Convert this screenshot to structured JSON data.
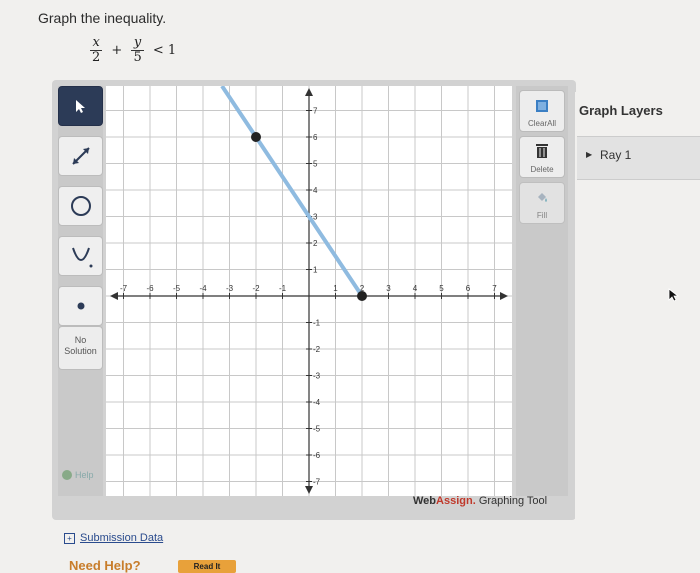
{
  "question": {
    "prompt": "Graph the inequality."
  },
  "inequality": {
    "term1_num": "x",
    "term1_den": "2",
    "plus": "+",
    "term2_num": "y",
    "term2_den": "5",
    "relation": "< 1"
  },
  "toolbar": {
    "tools": [
      {
        "name": "pointer",
        "icon": "arrow-cursor-icon",
        "active": true
      },
      {
        "name": "ray",
        "icon": "ray-icon"
      },
      {
        "name": "circle",
        "icon": "circle-icon"
      },
      {
        "name": "parabola",
        "icon": "parabola-icon"
      },
      {
        "name": "point",
        "icon": "point-icon"
      }
    ],
    "no_solution_line1": "No",
    "no_solution_line2": "Solution",
    "help_label": "Help"
  },
  "graph": {
    "x_ticks": [
      "-7",
      "-6",
      "-5",
      "-4",
      "-3",
      "-2",
      "-1",
      "1",
      "2",
      "3",
      "4",
      "5",
      "6",
      "7"
    ],
    "y_ticks": [
      "7",
      "6",
      "5",
      "4",
      "3",
      "2",
      "1",
      "-1",
      "-2",
      "-3",
      "-4",
      "-5",
      "-6",
      "-7"
    ],
    "ray": {
      "points": [
        [
          -2,
          6
        ],
        [
          2,
          0
        ]
      ],
      "color": "#8fbbe0"
    }
  },
  "right_tools": {
    "clear_all": "ClearAll",
    "delete": "Delete",
    "fill": "Fill"
  },
  "footer": {
    "brand_web": "Web",
    "brand_assign": "Assign.",
    "tool_name": "Graphing Tool"
  },
  "layers": {
    "title": "Graph Layers",
    "items": [
      "Ray 1"
    ]
  },
  "links": {
    "submission_data": "Submission Data",
    "need_help": "Need Help?",
    "read_it": "Read It"
  }
}
